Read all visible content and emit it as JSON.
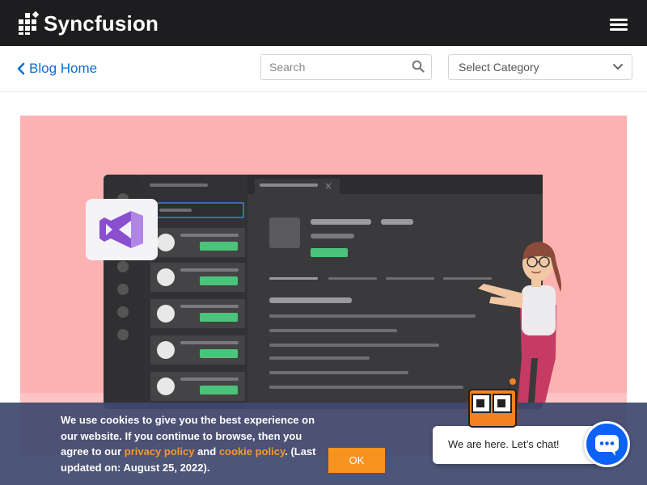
{
  "header": {
    "brand": "Syncfusion",
    "menu_icon": "hamburger-menu-icon"
  },
  "subnav": {
    "back_label": "Blog Home",
    "search_placeholder": "Search",
    "category_label": "Select Category"
  },
  "hero": {
    "illustration": "visual-studio-app-illustration",
    "colors": {
      "background": "#fdb2b2",
      "vs_purple": "#8a4fcf"
    }
  },
  "cookie": {
    "text_before": "We use cookies to give you the best experience on our website. If you continue to browse, then you agree to our ",
    "privacy_link": "privacy policy",
    "and": " and ",
    "cookie_link": "cookie policy",
    "text_after": ". (Last updated on: August 25, 2022).",
    "ok_label": "OK"
  },
  "chat": {
    "bubble_text": "We are here. Let’s chat!",
    "icon": "chat-icon"
  },
  "colors": {
    "topbar": "#1d1d1f",
    "link": "#0a6ed1",
    "accent": "#f7931e",
    "chat_blue": "#0b62f5"
  }
}
